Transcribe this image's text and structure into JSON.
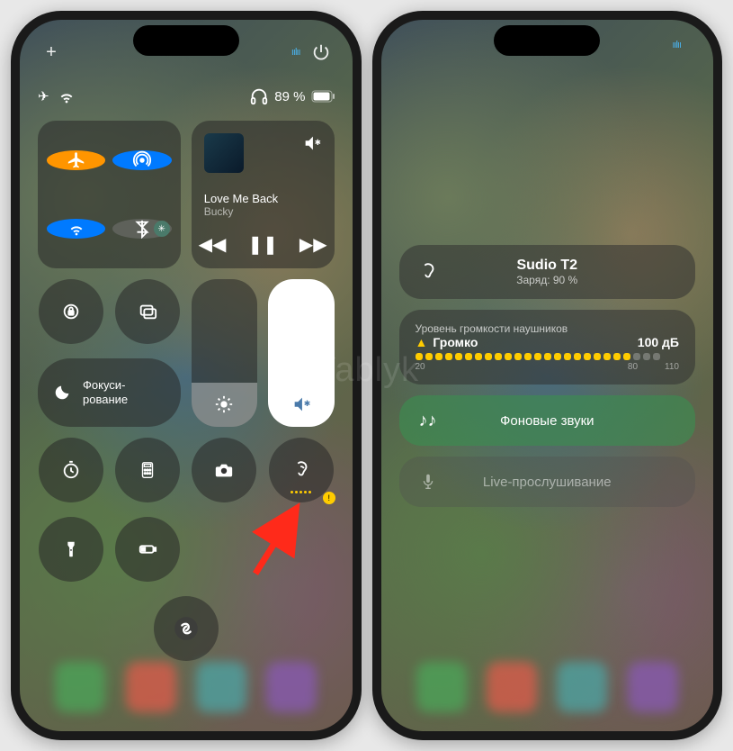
{
  "left": {
    "top": {
      "plus": "+",
      "power": "⏻",
      "audio_vis": "ıılıı"
    },
    "status": {
      "airplane": "✈︎",
      "wifi": "wifi",
      "headphones": "🎧",
      "battery_pct": "89 %",
      "battery_icon": "battery"
    },
    "connectivity": {
      "airplane": "airplane-icon",
      "airdrop": "airdrop-icon",
      "wifi": "wifi-icon",
      "bluetooth": "bluetooth-icon"
    },
    "music": {
      "title": "Love Me Back",
      "artist": "Bucky",
      "output_icon": "speaker-bt",
      "controls": {
        "back": "◀◀",
        "pause": "❚❚",
        "fwd": "▶▶"
      }
    },
    "tiles": {
      "lock": "rotation-lock-icon",
      "mirroring": "screen-mirroring-icon",
      "focus_label": "Фокуси-\nрование",
      "brightness": "brightness-icon",
      "volume": "volume-icon",
      "timer": "timer-icon",
      "calculator": "calculator-icon",
      "camera": "camera-icon",
      "hearing": "hearing-icon",
      "flashlight": "flashlight-icon",
      "lowpower": "low-power-icon",
      "shazam": "shazam-icon"
    }
  },
  "right": {
    "top_audio_vis": "ıılıı",
    "device": {
      "name": "Sudio T2",
      "charge_label": "Заряд: 90 %"
    },
    "loudness": {
      "header": "Уровень громкости наушников",
      "status": "Громко",
      "value": "100 дБ",
      "axis": [
        "20",
        "80",
        "110"
      ]
    },
    "background_sounds": "Фоновые звуки",
    "live_listen": "Live-прослушивание"
  },
  "watermark": "Yablyk"
}
